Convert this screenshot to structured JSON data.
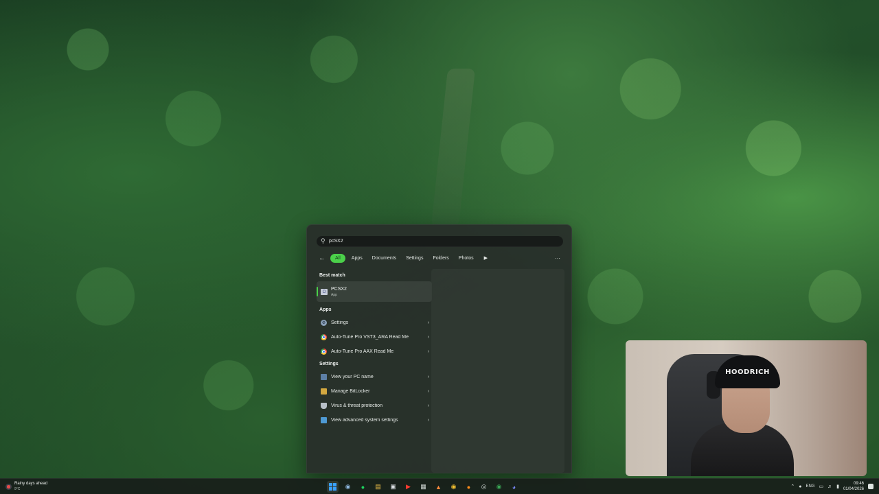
{
  "search": {
    "query": "pcSX2",
    "filters": [
      "All",
      "Apps",
      "Documents",
      "Settings",
      "Folders",
      "Photos"
    ],
    "more_icon": "play-icon",
    "ellipsis": "···"
  },
  "best_match": {
    "heading": "Best match",
    "title": "PCSX2",
    "subtitle": "App",
    "icon": "pcsx2-icon"
  },
  "apps": {
    "heading": "Apps",
    "items": [
      {
        "label": "Settings",
        "icon": "gear-icon"
      },
      {
        "label": "Auto-Tune Pro VST3_ARA Read Me",
        "icon": "chrome-icon"
      },
      {
        "label": "Auto-Tune Pro AAX Read Me",
        "icon": "chrome-icon"
      }
    ]
  },
  "settings": {
    "heading": "Settings",
    "items": [
      {
        "label": "View your PC name",
        "icon": "monitor-icon"
      },
      {
        "label": "Manage BitLocker",
        "icon": "bitlocker-icon"
      },
      {
        "label": "Virus & threat protection",
        "icon": "shield-icon"
      },
      {
        "label": "View advanced system settings",
        "icon": "advanced-system-icon"
      }
    ]
  },
  "webcam": {
    "cap_text": "HOODRICH"
  },
  "taskbar": {
    "weather_title": "Rainy days ahead",
    "weather_temp": "9°C",
    "language": "ENG",
    "time": "09:46",
    "date": "01/04/2026",
    "pinned_icons": [
      "windows-start-icon",
      "steam-icon",
      "spotify-icon",
      "file-explorer-icon",
      "store-icon",
      "youtube-icon",
      "calendar-icon",
      "app-icon",
      "chrome-icon",
      "firefox-icon",
      "app-icon",
      "chrome-icon",
      "discord-icon"
    ]
  },
  "colors": {
    "accent": "#4bd14a",
    "panel": "#282e2a"
  }
}
